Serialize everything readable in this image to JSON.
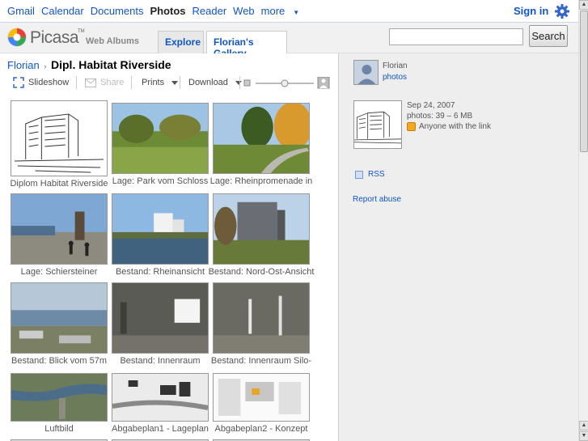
{
  "gbar": {
    "links": [
      "Gmail",
      "Calendar",
      "Documents",
      "Photos",
      "Reader",
      "Web",
      "more"
    ],
    "active": "Photos",
    "signin": "Sign in",
    "gear_icon": "gear-icon",
    "accent": "#1155cc"
  },
  "header": {
    "logo_text": "Picasa",
    "logo_tm": "TM",
    "logo_sub": "Web Albums",
    "tabs": [
      "Explore",
      "Florian's Gallery"
    ],
    "search_placeholder": "",
    "search_button": "Search"
  },
  "main": {
    "breadcrumb_link": "Florian",
    "breadcrumb_sep": "›",
    "album_title": "Dipl. Habitat Riverside",
    "toolbar": {
      "slideshow": "Slideshow",
      "share": "Share",
      "prints": "Prints",
      "download": "Download"
    },
    "photos": [
      {
        "caption": "Diplom Habitat Riverside",
        "kind": "sketch"
      },
      {
        "caption": "Lage: Park vom Schloss",
        "kind": "park"
      },
      {
        "caption": "Lage: Rheinpromenade in",
        "kind": "autumn"
      },
      {
        "caption": "Lage: Schiersteiner",
        "kind": "promenade"
      },
      {
        "caption": "Bestand: Rheinansicht",
        "kind": "river"
      },
      {
        "caption": "Bestand: Nord-Ost-Ansicht",
        "kind": "silo"
      },
      {
        "caption": "Bestand: Blick vom 57m",
        "kind": "aerial"
      },
      {
        "caption": "Bestand: Innenraum",
        "kind": "interior"
      },
      {
        "caption": "Bestand: Innenraum Silo-",
        "kind": "interior2"
      },
      {
        "caption": "Luftbild",
        "kind": "map"
      },
      {
        "caption": "Abgabeplan1 - Lageplan",
        "kind": "plan"
      },
      {
        "caption": "Abgabeplan2 - Konzept",
        "kind": "plan2"
      }
    ]
  },
  "sidebar": {
    "owner_name": "Florian",
    "owner_photos": "photos",
    "album_date": "Sep 24, 2007",
    "album_photos": "photos: 39 – 6 MB",
    "album_access": "Anyone with the link",
    "rss": "RSS",
    "report": "Report abuse",
    "toggle": "»"
  },
  "colors": {
    "link": "#1155cc",
    "header_bg": "#f1f1f1",
    "sidebar_bg": "#eeeeee"
  }
}
